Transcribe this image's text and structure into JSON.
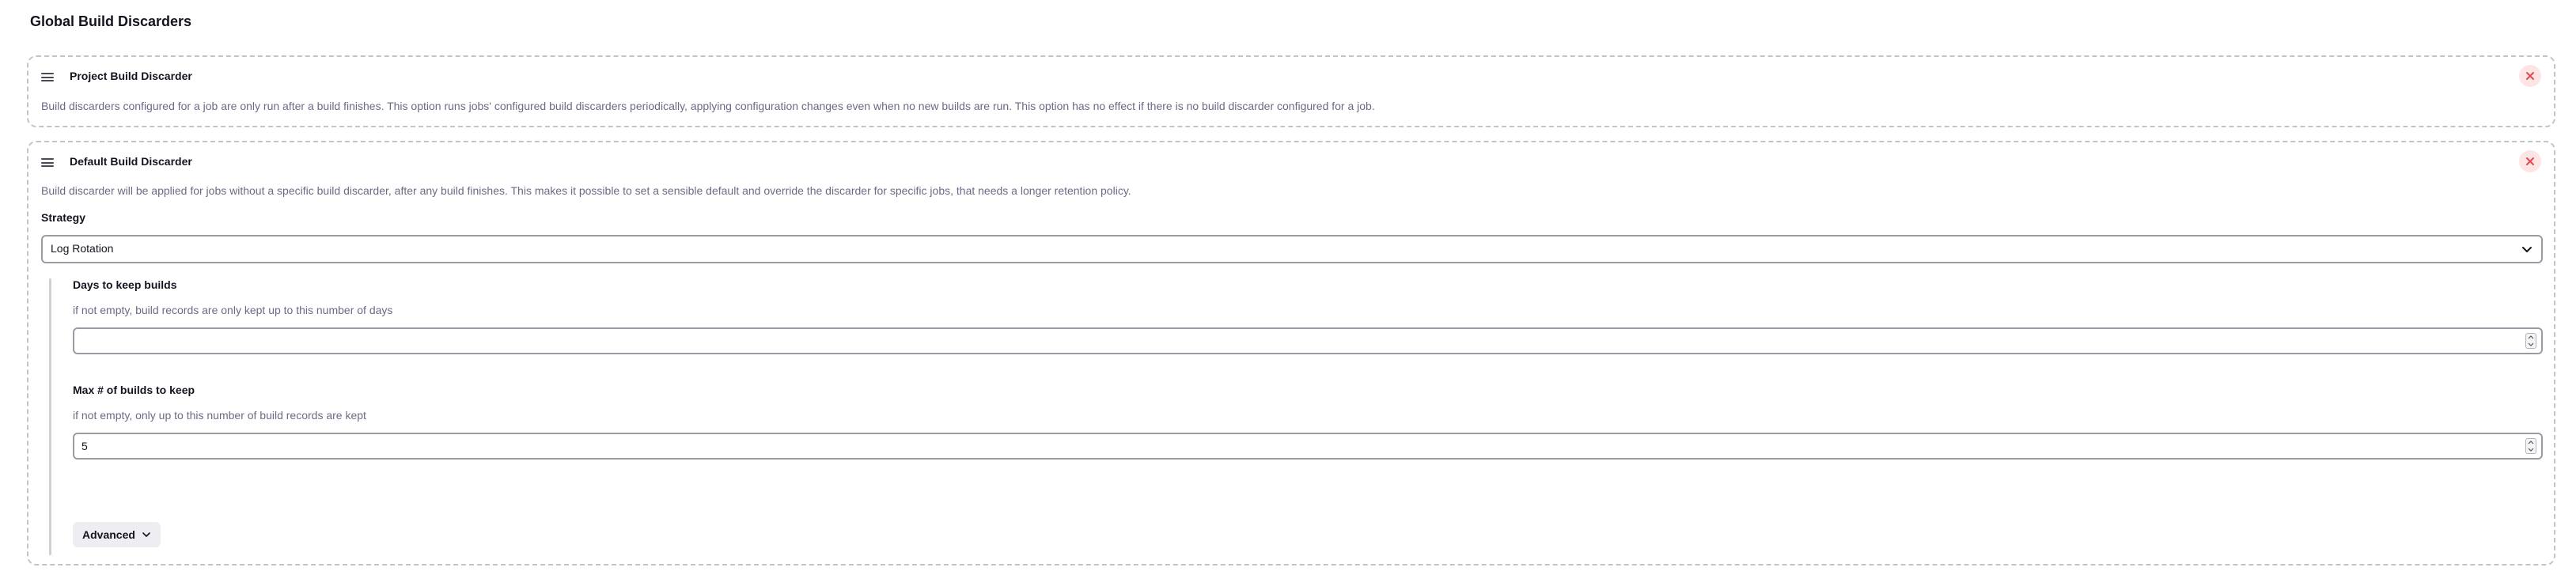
{
  "section": {
    "title": "Global Build Discarders"
  },
  "project_discarder": {
    "title": "Project Build Discarder",
    "description": "Build discarders configured for a job are only run after a build finishes. This option runs jobs' configured build discarders periodically, applying configuration changes even when no new builds are run. This option has no effect if there is no build discarder configured for a job."
  },
  "default_discarder": {
    "title": "Default Build Discarder",
    "description": "Build discarder will be applied for jobs without a specific build discarder, after any build finishes. This makes it possible to set a sensible default and override the discarder for specific jobs, that needs a longer retention policy.",
    "strategy_label": "Strategy",
    "strategy_value": "Log Rotation",
    "days_label": "Days to keep builds",
    "days_help": "if not empty, build records are only kept up to this number of days",
    "days_value": "",
    "max_label": "Max # of builds to keep",
    "max_help": "if not empty, only up to this number of build records are kept",
    "max_value": "5",
    "advanced_label": "Advanced"
  },
  "icons": {
    "drag": "drag-handle-icon",
    "delete": "close-icon",
    "select": "chevron-down-icon",
    "spinner": "spinner-arrows-icon",
    "advanced": "chevron-down-icon"
  },
  "colors": {
    "delete_bg": "#fde5e6",
    "delete_fg": "#e5484d",
    "border_dashed": "#c3c3ca",
    "muted_text": "#6b6b86",
    "nested_bar": "#cfcfd6"
  }
}
